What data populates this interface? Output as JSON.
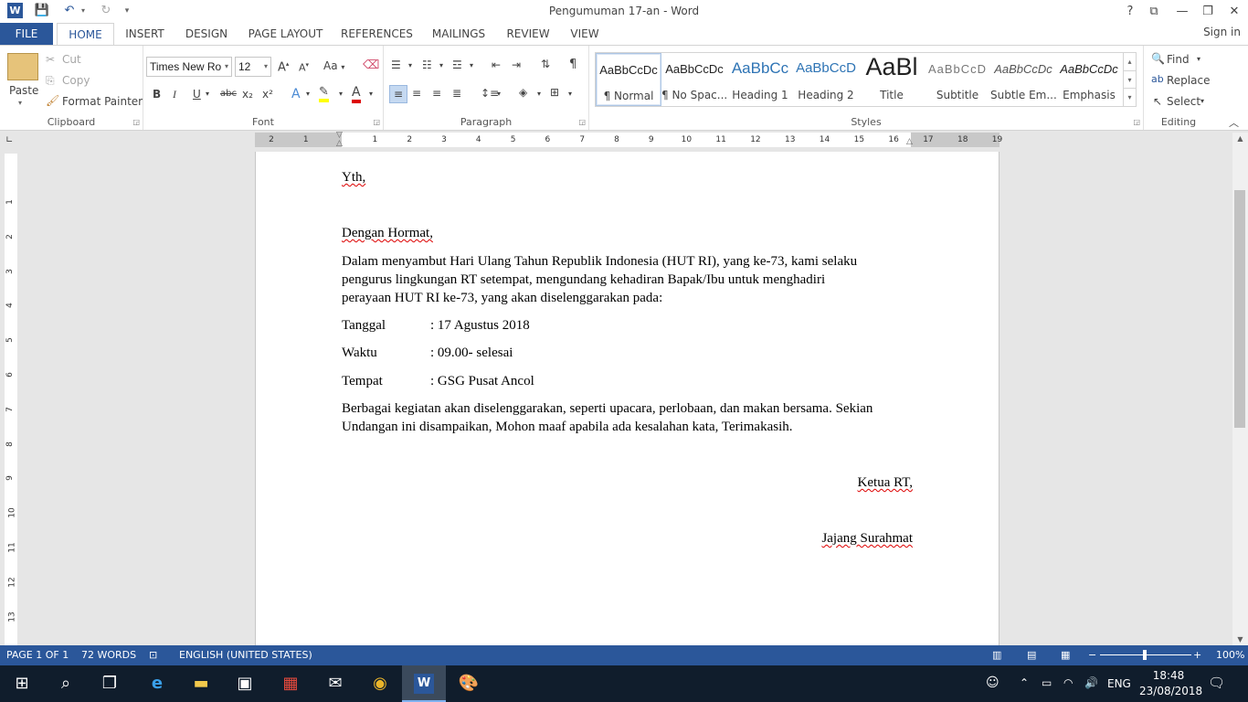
{
  "window": {
    "title": "Pengumuman 17-an - Word"
  },
  "qat": {
    "save": "💾",
    "undo": "↶",
    "redo": "↻"
  },
  "tabs": {
    "file": "FILE",
    "home": "HOME",
    "insert": "INSERT",
    "design": "DESIGN",
    "page_layout": "PAGE LAYOUT",
    "references": "REFERENCES",
    "mailings": "MAILINGS",
    "review": "REVIEW",
    "view": "VIEW",
    "sign_in": "Sign in"
  },
  "clipboard": {
    "paste": "Paste",
    "cut": "Cut",
    "copy": "Copy",
    "format_painter": "Format Painter",
    "label": "Clipboard"
  },
  "font": {
    "family": "Times New Ro",
    "size": "12",
    "label": "Font",
    "grow": "A",
    "shrink": "A",
    "case": "Aa",
    "bold": "B",
    "italic": "I",
    "underline": "U",
    "strike": "abc",
    "sub": "x₂",
    "sup": "x²"
  },
  "paragraph": {
    "label": "Paragraph"
  },
  "styles": {
    "label": "Styles",
    "items": [
      {
        "preview": "AaBbCcDc",
        "name": "¶ Normal"
      },
      {
        "preview": "AaBbCcDc",
        "name": "¶ No Spac..."
      },
      {
        "preview": "AaBbCc",
        "name": "Heading 1"
      },
      {
        "preview": "AaBbCcD",
        "name": "Heading 2"
      },
      {
        "preview": "AaBl",
        "name": "Title"
      },
      {
        "preview": "AaBbCcD",
        "name": "Subtitle"
      },
      {
        "preview": "AaBbCcDc",
        "name": "Subtle Em..."
      },
      {
        "preview": "AaBbCcDc",
        "name": "Emphasis"
      }
    ]
  },
  "editing": {
    "find": "Find",
    "replace": "Replace",
    "select": "Select",
    "label": "Editing"
  },
  "ruler": {
    "h": [
      "2",
      "1",
      "1",
      "2",
      "3",
      "4",
      "5",
      "6",
      "7",
      "8",
      "9",
      "10",
      "11",
      "12",
      "13",
      "14",
      "15",
      "16",
      "17",
      "18",
      "19"
    ],
    "v": [
      "1",
      "2",
      "3",
      "4",
      "5",
      "6",
      "7",
      "8",
      "9",
      "10",
      "11",
      "12",
      "13"
    ]
  },
  "document": {
    "yth": "Yth,",
    "greeting": "Dengan Hormat,",
    "intro": [
      "Dalam menyambut Hari Ulang Tahun Republik Indonesia (HUT RI), yang ke-73, kami selaku",
      "pengurus lingkungan RT setempat, mengundang kehadiran Bapak/Ibu untuk menghadiri",
      "perayaan HUT RI ke-73, yang akan diselenggarakan pada:"
    ],
    "details": [
      {
        "label": "Tanggal",
        "value": ": 17 Agustus 2018"
      },
      {
        "label": "Waktu",
        "value": ":  09.00- selesai"
      },
      {
        "label": "Tempat",
        "value": ": GSG Pusat Ancol"
      }
    ],
    "closing": [
      "Berbagai kegiatan akan diselenggarakan, seperti upacara, perlobaan, dan makan bersama. Sekian",
      "Undangan ini disampaikan, Mohon maaf apabila ada kesalahan kata, Terimakasih."
    ],
    "sign_title": "Ketua RT,",
    "sign_name": "Jajang Surahmat"
  },
  "status": {
    "page": "PAGE 1 OF 1",
    "words": "72 WORDS",
    "language": "ENGLISH (UNITED STATES)",
    "zoom": "100%"
  },
  "taskbar": {
    "lang": "ENG",
    "time": "18:48",
    "date": "23/08/2018"
  }
}
